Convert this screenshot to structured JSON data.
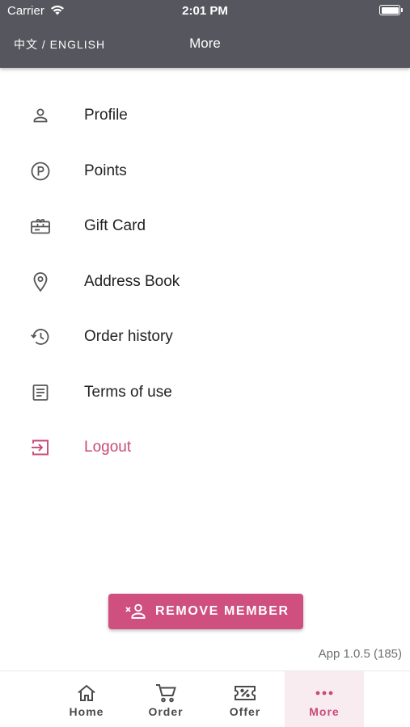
{
  "status_bar": {
    "carrier": "Carrier",
    "time": "2:01 PM"
  },
  "header": {
    "lang_toggle": "中文 / ENGLISH",
    "title": "More"
  },
  "menu": [
    {
      "label": "Profile",
      "icon": "person-icon"
    },
    {
      "label": "Points",
      "icon": "points-icon"
    },
    {
      "label": "Gift Card",
      "icon": "gift-card-icon"
    },
    {
      "label": "Address Book",
      "icon": "location-pin-icon"
    },
    {
      "label": "Order history",
      "icon": "history-icon"
    },
    {
      "label": "Terms of use",
      "icon": "document-icon"
    },
    {
      "label": "Logout",
      "icon": "logout-icon"
    }
  ],
  "remove_member": {
    "label": "REMOVE MEMBER",
    "icon": "remove-user-icon"
  },
  "version": "App 1.0.5 (185)",
  "tabs": [
    {
      "label": "Home",
      "icon": "home-icon"
    },
    {
      "label": "Order",
      "icon": "cart-icon"
    },
    {
      "label": "Offer",
      "icon": "coupon-icon"
    },
    {
      "label": "More",
      "icon": "more-dots-icon",
      "active": true
    }
  ],
  "colors": {
    "header": "#56565e",
    "accent": "#cf4f7e",
    "active_tab_bg": "#f9ecf1"
  }
}
